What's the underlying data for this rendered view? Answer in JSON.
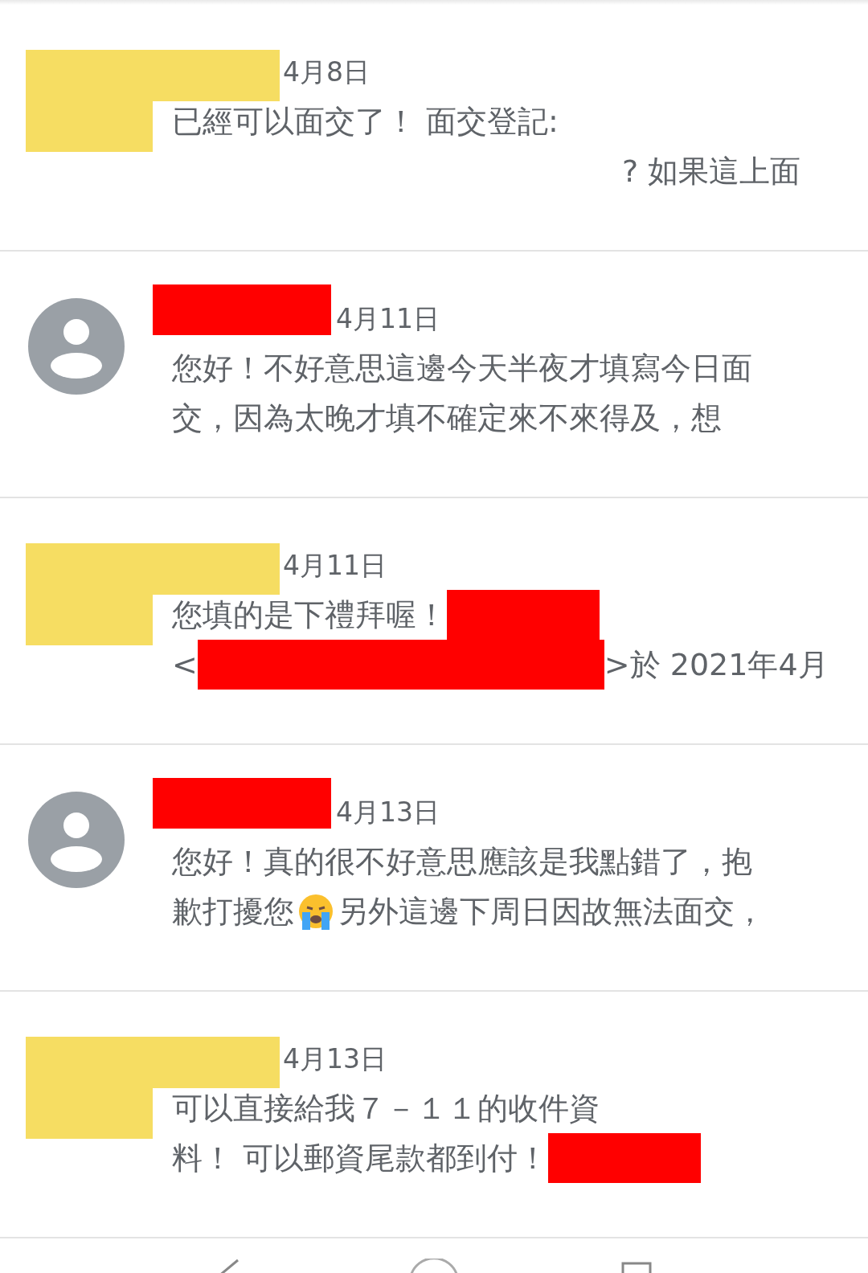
{
  "messages": [
    {
      "kind": "self",
      "date": "4月8日",
      "lines": [
        [
          {
            "kind": "text",
            "text": "已經可以面交了！ 面交登記:"
          }
        ],
        [
          {
            "kind": "gap"
          },
          {
            "kind": "text",
            "text": "? 如果這上面"
          }
        ]
      ]
    },
    {
      "kind": "other",
      "date": "4月11日",
      "lines": [
        [
          {
            "kind": "text",
            "text": "您好！不好意思這邊今天半夜才填寫今日面"
          }
        ],
        [
          {
            "kind": "text",
            "text": "交，因為太晚才填不確定來不來得及，想"
          }
        ]
      ]
    },
    {
      "kind": "self",
      "date": "4月11日",
      "lines": [
        [
          {
            "kind": "text",
            "text": "您填的是下禮拜喔！"
          },
          {
            "kind": "redaction",
            "color": "#ff0000"
          }
        ],
        [
          {
            "kind": "text",
            "text": "<"
          },
          {
            "kind": "wide_redaction",
            "color": "#ff0000"
          },
          {
            "kind": "text",
            "text": ">於 2021年4月"
          }
        ]
      ]
    },
    {
      "kind": "other",
      "date": "4月13日",
      "lines": [
        [
          {
            "kind": "text",
            "text": "您好！真的很不好意思應該是我點錯了，抱"
          }
        ],
        [
          {
            "kind": "text",
            "text": "歉打擾您"
          },
          {
            "kind": "emoji"
          },
          {
            "kind": "text",
            "text": "另外這邊下周日因故無法面交，"
          }
        ]
      ]
    },
    {
      "kind": "self",
      "date": "4月13日",
      "lines": [
        [
          {
            "kind": "text",
            "text": "可以直接給我７－１１的收件資"
          }
        ],
        [
          {
            "kind": "text",
            "text": "料！ 可以郵資尾款都到付！"
          },
          {
            "kind": "redaction",
            "color": "#ff0000"
          }
        ]
      ]
    }
  ]
}
